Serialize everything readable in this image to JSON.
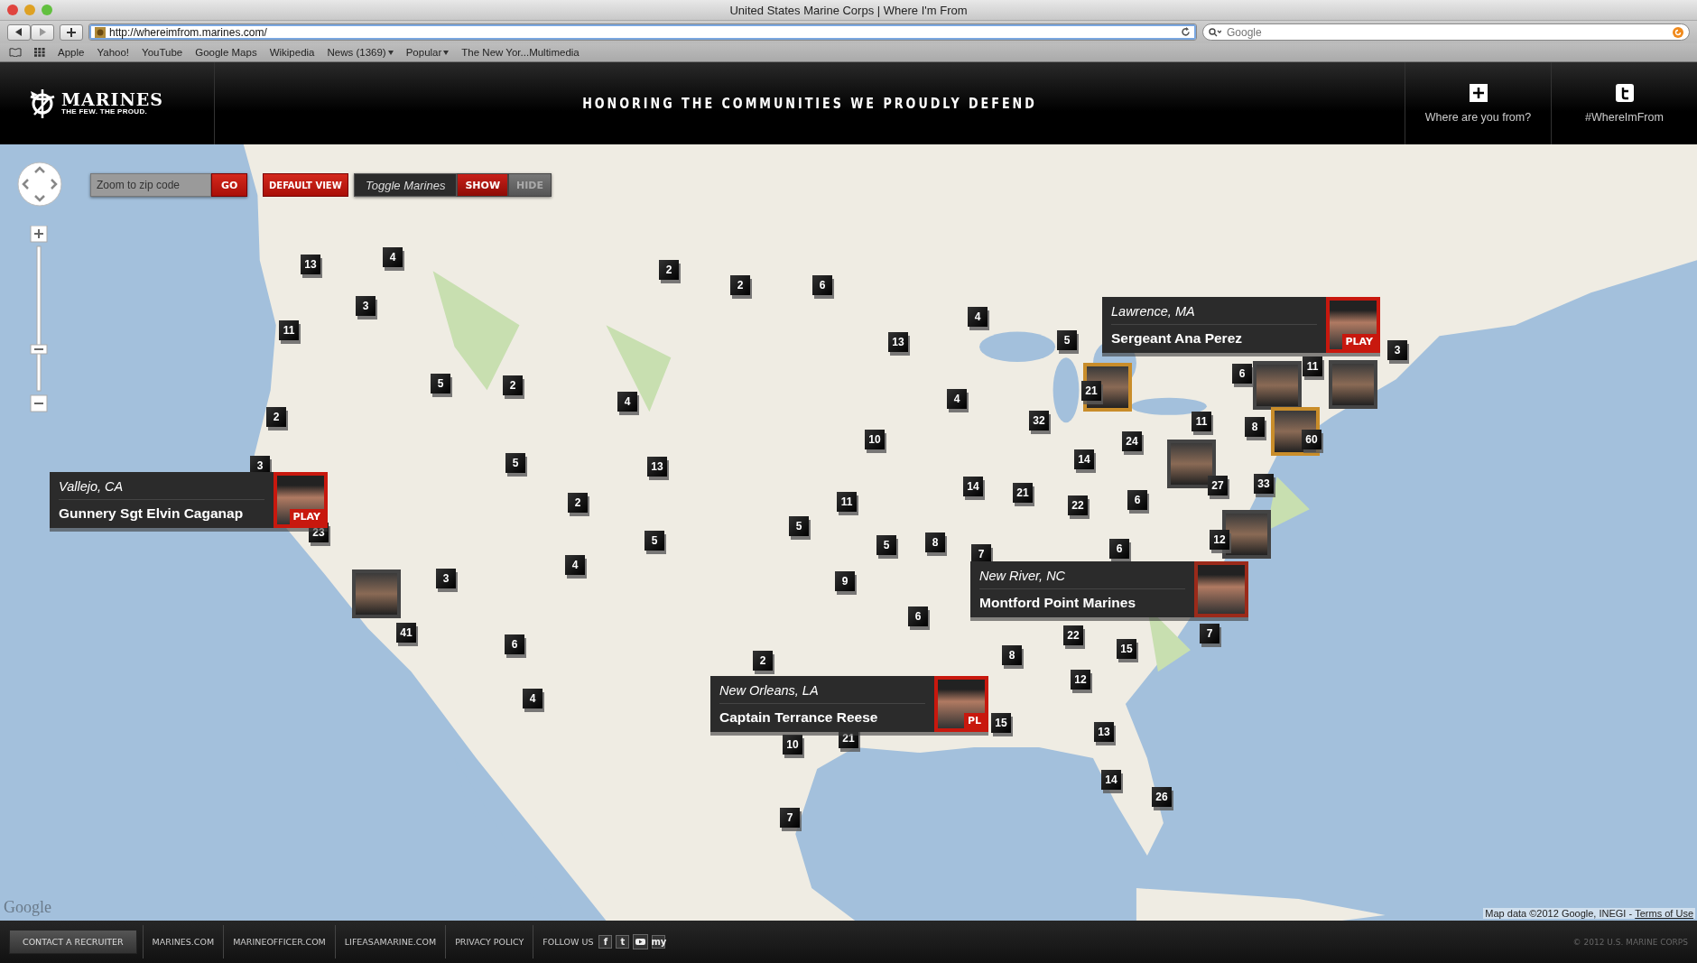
{
  "browser": {
    "title": "United States Marine Corps | Where I'm From",
    "url": "http://whereimfrom.marines.com/",
    "search": {
      "placeholder": "Google"
    },
    "bookmarks": [
      {
        "label": "Apple",
        "kind": "link"
      },
      {
        "label": "Yahoo!",
        "kind": "link"
      },
      {
        "label": "YouTube",
        "kind": "link"
      },
      {
        "label": "Google Maps",
        "kind": "link"
      },
      {
        "label": "Wikipedia",
        "kind": "link"
      },
      {
        "label": "News (1369)",
        "kind": "menu"
      },
      {
        "label": "Popular",
        "kind": "menu"
      },
      {
        "label": "The New Yor...Multimedia",
        "kind": "link"
      }
    ]
  },
  "header": {
    "logo": {
      "name": "MARINES",
      "motto": "THE FEW. THE PROUD."
    },
    "tagline": "HONORING THE COMMUNITIES WE PROUDLY DEFEND",
    "actions": [
      {
        "kind": "add",
        "label": "Where are you from?"
      },
      {
        "kind": "twitter",
        "label": "#WhereImFrom"
      }
    ]
  },
  "map": {
    "zoom": {
      "level": 0.3
    },
    "zip": {
      "placeholder": "Zoom to zip code",
      "button": "GO"
    },
    "default_view": "DEFAULT VIEW",
    "toggle": {
      "label": "Toggle Marines",
      "options": [
        {
          "label": "SHOW",
          "selected": true
        },
        {
          "label": "HIDE",
          "selected": false
        }
      ]
    },
    "photo_markers": [
      {
        "featured": true
      },
      {
        "featured": false
      },
      {
        "featured": false
      },
      {
        "featured": true
      },
      {
        "featured": false
      },
      {
        "featured": false
      },
      {
        "featured": false
      }
    ],
    "markers": [
      "13",
      "4",
      "3",
      "11",
      "5",
      "2",
      "2",
      "3",
      "23",
      "5",
      "2",
      "2",
      "6",
      "13",
      "4",
      "5",
      "4",
      "13",
      "2",
      "5",
      "4",
      "3",
      "41",
      "6",
      "4",
      "10",
      "4",
      "32",
      "11",
      "8",
      "24",
      "14",
      "14",
      "21",
      "11",
      "5",
      "22",
      "6",
      "27",
      "33",
      "12",
      "5",
      "8",
      "7",
      "6",
      "9",
      "6",
      "22",
      "8",
      "15",
      "7",
      "12",
      "2",
      "15",
      "21",
      "10",
      "13",
      "14",
      "26",
      "7",
      "3",
      "6",
      "11",
      "21",
      "60"
    ],
    "callouts": [
      {
        "place": "Lawrence, MA",
        "name": "Sergeant Ana Perez",
        "play": "PLAY"
      },
      {
        "place": "Vallejo, CA",
        "name": "Gunnery Sgt Elvin Caganap",
        "play": "PLAY"
      },
      {
        "place": "New River, NC",
        "name": "Montford Point Marines"
      },
      {
        "place": "New Orleans, LA",
        "name": "Captain Terrance Reese",
        "play": "PL"
      }
    ],
    "logo": "Google",
    "attribution": "Map data ©2012 Google, INEGI - ",
    "terms": "Terms of Use"
  },
  "footer": {
    "button": "CONTACT A RECRUITER",
    "links": [
      "MARINES.COM",
      "MARINEOFFICER.COM",
      "LIFEASAMARINE.COM",
      "PRIVACY POLICY"
    ],
    "follow": "FOLLOW US",
    "social": [
      {
        "kind": "facebook",
        "glyph": "f"
      },
      {
        "kind": "twitter",
        "glyph": "t"
      },
      {
        "kind": "youtube"
      },
      {
        "kind": "myspace",
        "glyph": "my"
      }
    ],
    "copyright": "© 2012 U.S. MARINE CORPS"
  }
}
